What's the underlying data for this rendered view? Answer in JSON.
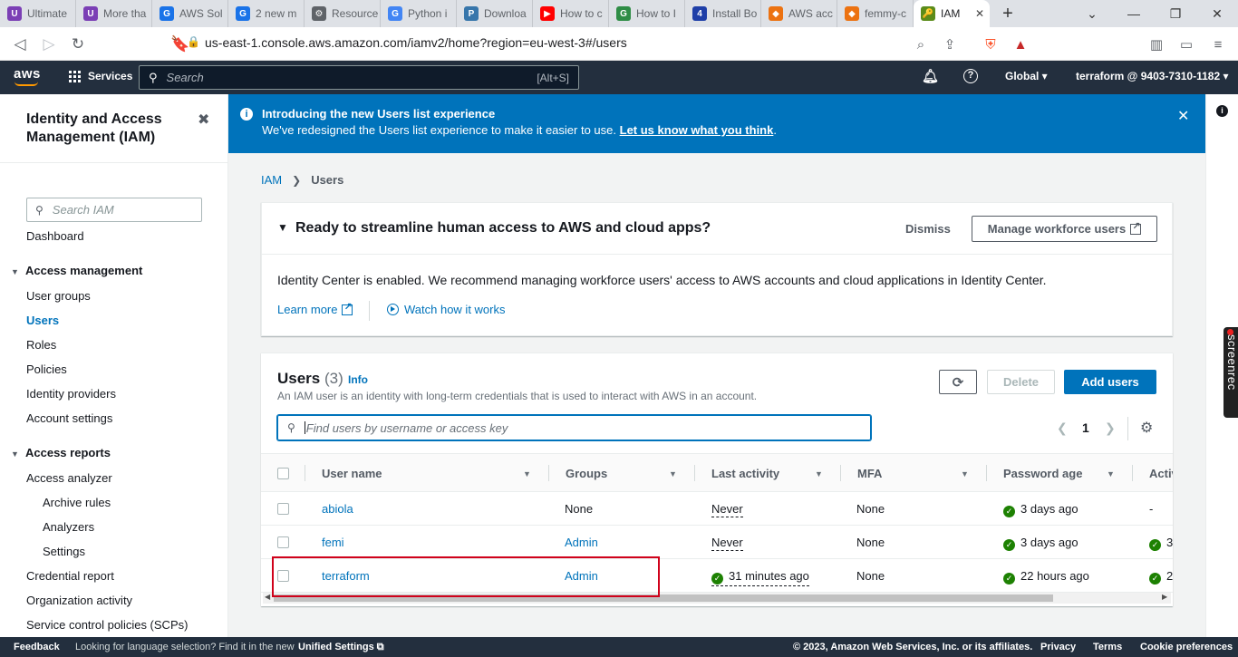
{
  "browser": {
    "tabs": [
      {
        "title": "Ultimate",
        "color": "#7b3fb5",
        "glyph": "U"
      },
      {
        "title": "More tha",
        "color": "#7b3fb5",
        "glyph": "U"
      },
      {
        "title": "AWS Sol",
        "color": "#1a73e8",
        "glyph": "G"
      },
      {
        "title": "2 new m",
        "color": "#1a73e8",
        "glyph": "G"
      },
      {
        "title": "Resource",
        "color": "#5f6368",
        "glyph": "⚙"
      },
      {
        "title": "Python i",
        "color": "#4285f4",
        "glyph": "G"
      },
      {
        "title": "Downloa",
        "color": "#3776ab",
        "glyph": "P"
      },
      {
        "title": "How to c",
        "color": "#ff0000",
        "glyph": "▶"
      },
      {
        "title": "How to I",
        "color": "#2f8d46",
        "glyph": "G"
      },
      {
        "title": "Install Bo",
        "color": "#1f3fa8",
        "glyph": "4"
      },
      {
        "title": "AWS acc",
        "color": "#ec7211",
        "glyph": "◆"
      },
      {
        "title": "femmy-c",
        "color": "#ec7211",
        "glyph": "◆"
      },
      {
        "title": "IAM",
        "color": "#5b8c1a",
        "glyph": "🔑",
        "active": true
      }
    ],
    "url": "us-east-1.console.aws.amazon.com/iamv2/home?region=eu-west-3#/users"
  },
  "aws_nav": {
    "logo": "aws",
    "services": "Services",
    "search_placeholder": "Search",
    "search_shortcut": "[Alt+S]",
    "region": "Global ▾",
    "account": "terraform @ 9403-7310-1182 ▾"
  },
  "sidebar": {
    "title": "Identity and Access Management (IAM)",
    "search_placeholder": "Search IAM",
    "dashboard": "Dashboard",
    "access_management": "Access management",
    "am_items": [
      "User groups",
      "Users",
      "Roles",
      "Policies",
      "Identity providers",
      "Account settings"
    ],
    "access_reports": "Access reports",
    "ar_items": [
      "Access analyzer",
      "Archive rules",
      "Analyzers",
      "Settings",
      "Credential report",
      "Organization activity",
      "Service control policies (SCPs)"
    ]
  },
  "flash": {
    "heading": "Introducing the new Users list experience",
    "body": "We've redesigned the Users list experience to make it easier to use.",
    "link": "Let us know what you think",
    "period": "."
  },
  "breadcrumb": {
    "root": "IAM",
    "current": "Users"
  },
  "identity_center": {
    "heading": "Ready to streamline human access to AWS and cloud apps?",
    "dismiss": "Dismiss",
    "manage_button": "Manage workforce users",
    "body": "Identity Center is enabled. We recommend managing workforce users' access to AWS accounts and cloud applications in Identity Center.",
    "learn_more": "Learn more",
    "watch": "Watch how it works"
  },
  "users": {
    "title": "Users",
    "count": "(3)",
    "info": "Info",
    "description": "An IAM user is an identity with long-term credentials that is used to interact with AWS in an account.",
    "delete": "Delete",
    "add": "Add users",
    "filter_placeholder": "Find users by username or access key",
    "page": "1",
    "columns": [
      "User name",
      "Groups",
      "Last activity",
      "MFA",
      "Password age",
      "Activ"
    ],
    "rows": [
      {
        "name": "abiola",
        "groups": "None",
        "activity": "Never",
        "activity_ok": false,
        "mfa": "None",
        "password_age": "3 days ago",
        "active": "-",
        "active_ok": false,
        "groups_link": false
      },
      {
        "name": "femi",
        "groups": "Admin",
        "activity": "Never",
        "activity_ok": false,
        "mfa": "None",
        "password_age": "3 days ago",
        "active": "3",
        "active_ok": true,
        "groups_link": true
      },
      {
        "name": "terraform",
        "groups": "Admin",
        "activity": "31 minutes ago",
        "activity_ok": true,
        "mfa": "None",
        "password_age": "22 hours ago",
        "active": "2",
        "active_ok": true,
        "groups_link": true
      }
    ]
  },
  "screenrec": "screenrec",
  "footer": {
    "feedback": "Feedback",
    "lang_text": "Looking for language selection? Find it in the new",
    "unified": "Unified Settings",
    "copyright": "© 2023, Amazon Web Services, Inc. or its affiliates.",
    "privacy": "Privacy",
    "terms": "Terms",
    "cookie": "Cookie preferences"
  }
}
